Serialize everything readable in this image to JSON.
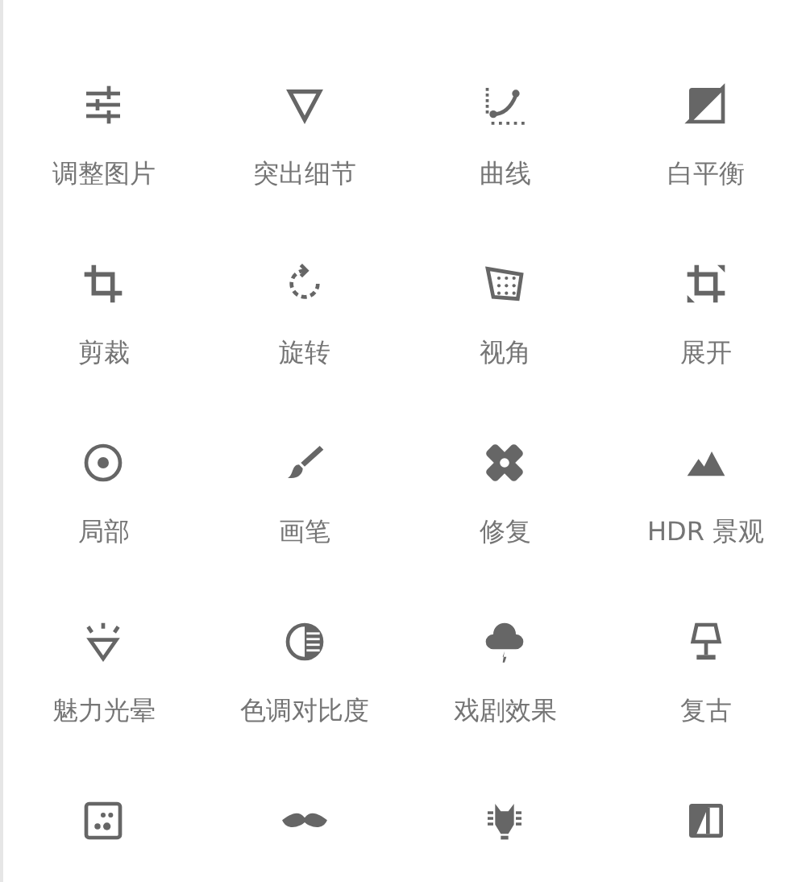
{
  "tools": [
    {
      "label": "调整图片"
    },
    {
      "label": "突出细节"
    },
    {
      "label": "曲线"
    },
    {
      "label": "白平衡"
    },
    {
      "label": "剪裁"
    },
    {
      "label": "旋转"
    },
    {
      "label": "视角"
    },
    {
      "label": "展开"
    },
    {
      "label": "局部"
    },
    {
      "label": "画笔"
    },
    {
      "label": "修复"
    },
    {
      "label": "HDR 景观"
    },
    {
      "label": "魅力光晕"
    },
    {
      "label": "色调对比度"
    },
    {
      "label": "戏剧效果"
    },
    {
      "label": "复古"
    }
  ]
}
